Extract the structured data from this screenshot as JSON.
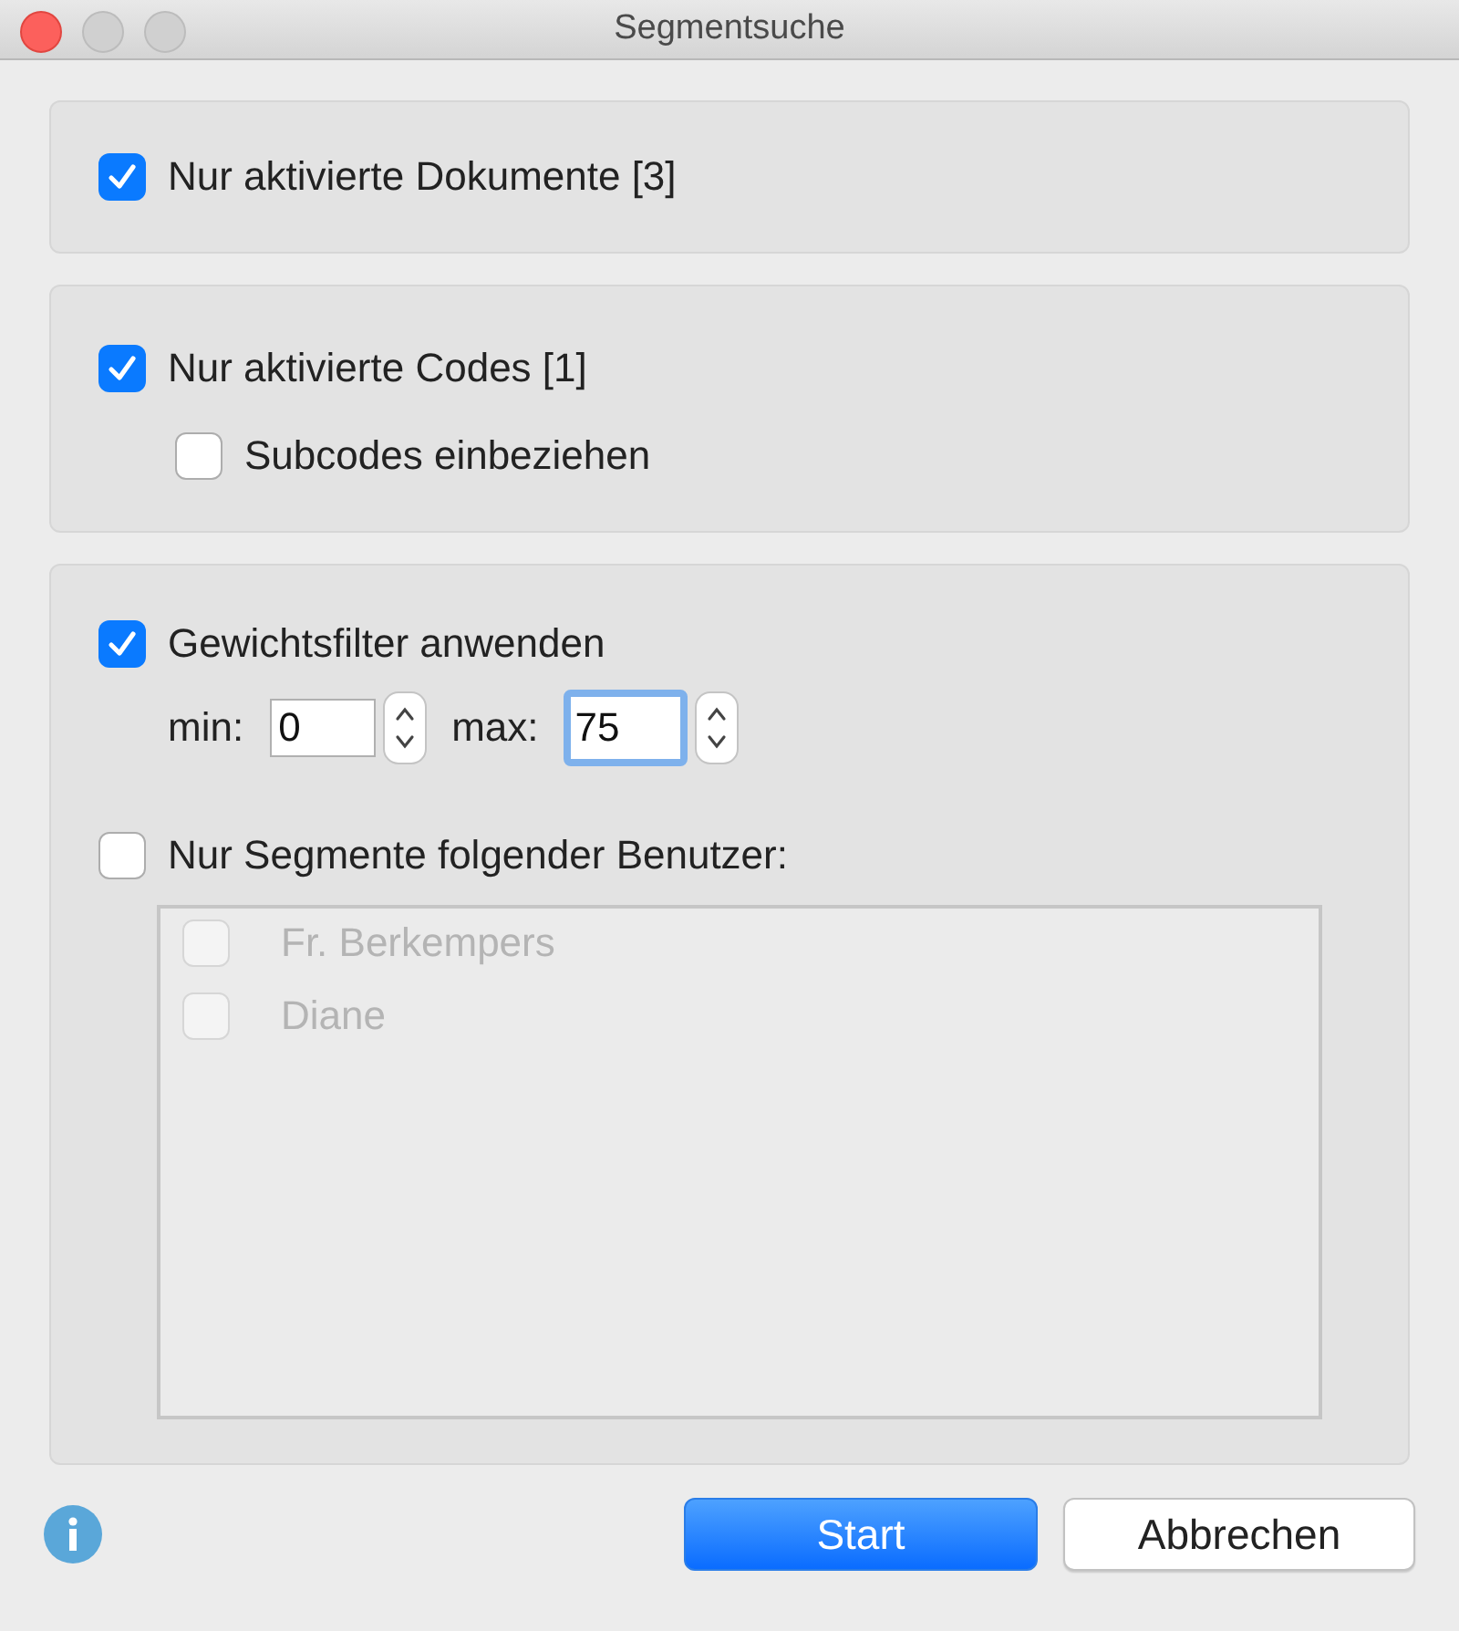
{
  "window": {
    "title": "Segmentsuche"
  },
  "documents_filter": {
    "label": "Nur aktivierte Dokumente [3]",
    "checked": true
  },
  "codes_filter": {
    "label": "Nur aktivierte Codes [1]",
    "checked": true,
    "subcodes": {
      "label": "Subcodes einbeziehen",
      "checked": false
    }
  },
  "weight_filter": {
    "label": "Gewichtsfilter anwenden",
    "checked": true,
    "min": {
      "label": "min:",
      "value": "0",
      "focused": false
    },
    "max": {
      "label": "max:",
      "value": "75",
      "focused": true
    }
  },
  "user_filter": {
    "label": "Nur Segmente folgender Benutzer:",
    "checked": false,
    "users": [
      {
        "name": "Fr. Berkempers",
        "checked": false,
        "disabled": true
      },
      {
        "name": "Diane",
        "checked": false,
        "disabled": true
      }
    ]
  },
  "buttons": [
    {
      "label": "Start",
      "kind": "primary"
    },
    {
      "label": "Abbrechen",
      "kind": "secondary"
    }
  ]
}
